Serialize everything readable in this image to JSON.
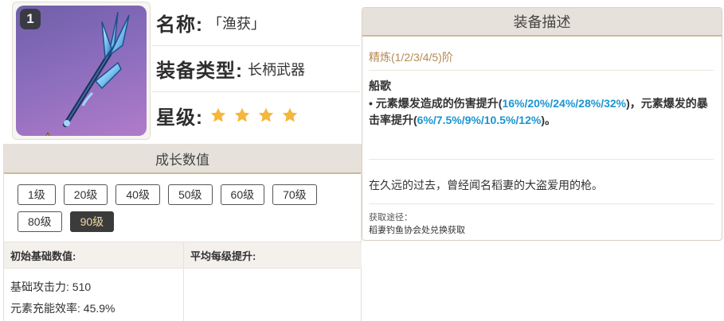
{
  "weapon": {
    "refinement_badge": "1",
    "name_key": "名称:",
    "name_value": "「渔获」",
    "type_key": "装备类型:",
    "type_value": "长柄武器",
    "rarity_key": "星级:",
    "rarity_stars": 4,
    "icon": "polearm-trident-icon",
    "star_color": "#f5b63a"
  },
  "growth": {
    "header": "成长数值",
    "levels": [
      "1级",
      "20级",
      "40级",
      "50级",
      "60级",
      "70级",
      "80级",
      "90级"
    ],
    "selected_level": "90级",
    "table_headers": [
      "初始基础数值:",
      "平均每级提升:"
    ],
    "stats": [
      "基础攻击力: 510",
      "元素充能效率: 45.9%"
    ]
  },
  "description": {
    "header": "装备描述",
    "refinement": "精炼(1/2/3/4/5)阶",
    "skill_name": "船歌",
    "skill_parts": [
      {
        "text": "• 元素爆发造成的伤害提升(",
        "hl": false
      },
      {
        "text": "16%/20%/24%/28%/32%",
        "hl": true
      },
      {
        "text": ")，元素爆发的暴击率提升(",
        "hl": false
      },
      {
        "text": "6%/7.5%/9%/10.5%/12%",
        "hl": true
      },
      {
        "text": ")。",
        "hl": false
      }
    ],
    "lore": "在久远的过去，曾经闻名稻妻的大盗爱用的枪。",
    "obtain_label": "获取途径：",
    "obtain_value": "稻妻钓鱼协会处兑换获取",
    "highlight_color": "#1a95d1",
    "refinement_color": "#b58a52"
  }
}
